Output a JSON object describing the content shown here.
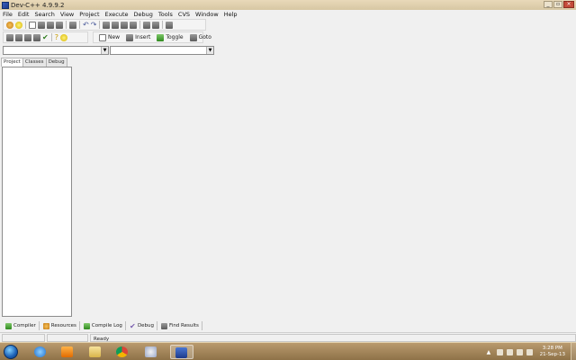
{
  "window": {
    "title": "Dev-C++ 4.9.9.2"
  },
  "menubar": [
    "File",
    "Edit",
    "Search",
    "View",
    "Project",
    "Execute",
    "Debug",
    "Tools",
    "CVS",
    "Window",
    "Help"
  ],
  "toolbar2": {
    "new_label": "New",
    "insert_label": "Insert",
    "toggle_label": "Toggle",
    "goto_label": "Goto"
  },
  "left_tabs": [
    "Project",
    "Classes",
    "Debug"
  ],
  "bottom_tabs": [
    "Compiler",
    "Resources",
    "Compile Log",
    "Debug",
    "Find Results"
  ],
  "status": {
    "text": "Ready"
  },
  "taskbar": {
    "apps": [
      "windows-start",
      "internet-explorer",
      "media-player",
      "file-explorer",
      "chrome",
      "paint",
      "dev-cpp"
    ],
    "clock_time": "3:28 PM",
    "clock_date": "21-Sep-13"
  },
  "colors": {
    "accent": "#1d3a8a",
    "taskbar": "#a68660"
  }
}
